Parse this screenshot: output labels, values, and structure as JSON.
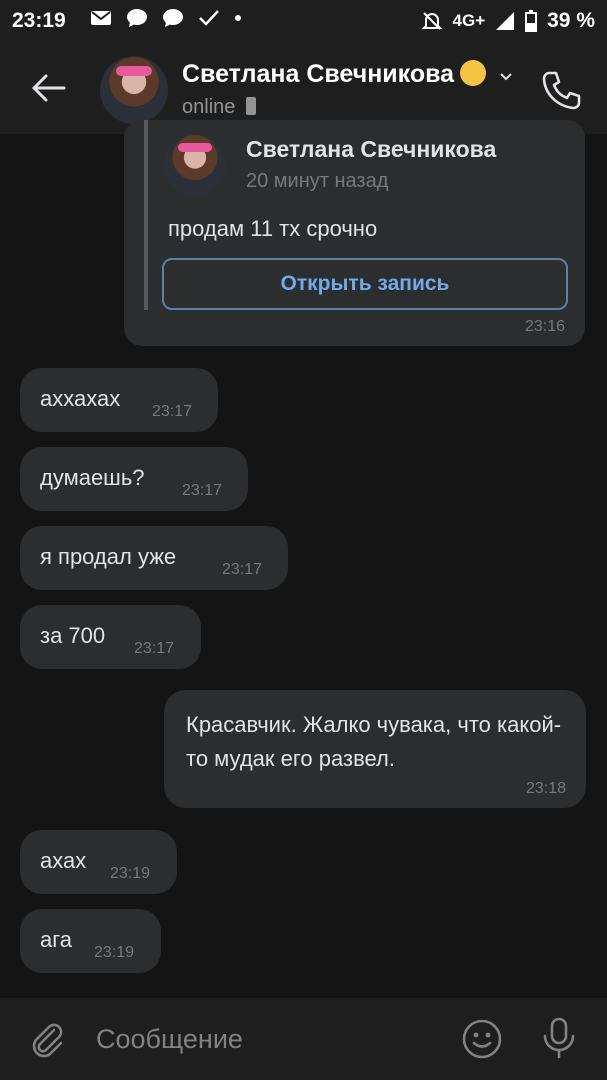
{
  "status_bar": {
    "time": "23:19",
    "network": "4G+",
    "battery": "39 %"
  },
  "header": {
    "name": "Светлана Свечникова",
    "status": "online"
  },
  "shared_post": {
    "author": "Светлана Свечникова",
    "posted": "20 минут назад",
    "text": "продам 11 тх срочно",
    "button": "Открыть запись",
    "time": "23:16"
  },
  "messages": [
    {
      "text": "аххахах",
      "time": "23:17"
    },
    {
      "text": "думаешь?",
      "time": "23:17"
    },
    {
      "text": "я продал уже",
      "time": "23:17"
    },
    {
      "text": "за 700",
      "time": "23:17"
    },
    {
      "text": "Красавчик. Жалко чувака, что какой-то мудак его развел.",
      "time": "23:18"
    },
    {
      "text": "ахах",
      "time": "23:19"
    },
    {
      "text": "ага",
      "time": "23:19"
    }
  ],
  "input": {
    "placeholder": "Сообщение"
  }
}
